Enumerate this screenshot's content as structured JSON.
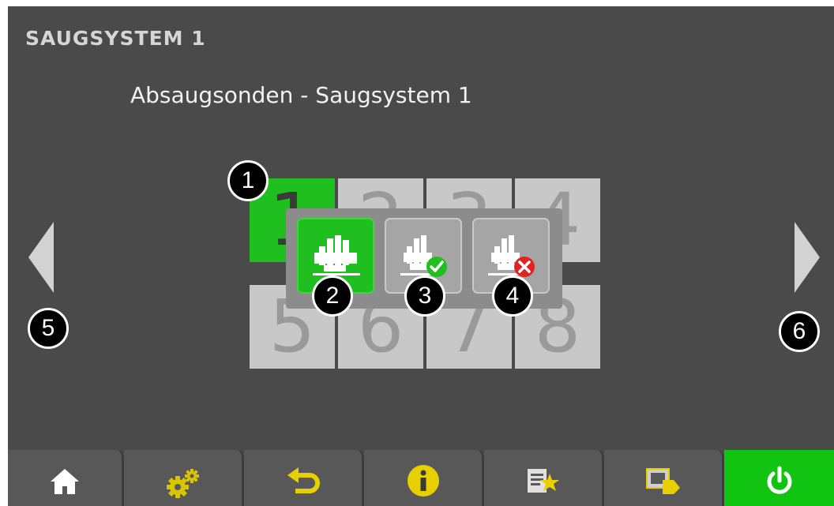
{
  "header": {
    "title": "SAUGSYSTEM 1"
  },
  "main": {
    "subtitle": "Absaugsonden - Saugsystem 1",
    "tiles": [
      "1",
      "2",
      "3",
      "4",
      "5",
      "6",
      "7",
      "8"
    ],
    "selected_tile": "1"
  },
  "callouts": [
    "1",
    "2",
    "3",
    "4",
    "5",
    "6"
  ],
  "popup": {
    "options": [
      "probe-icon",
      "probe-check-icon",
      "probe-cross-icon"
    ]
  },
  "navigation": {
    "prev": "chevron-left-icon",
    "next": "chevron-right-icon"
  },
  "toolbar": {
    "buttons": [
      "home-icon",
      "gears-icon",
      "back-icon",
      "info-icon",
      "favorites-icon",
      "remote-icon",
      "power-icon"
    ]
  },
  "colors": {
    "screen_bg": "#4a4a4a",
    "accent_green": "#1fbf1f",
    "tile_gray": "#c8c8c8",
    "toolbar_bg": "#585858",
    "info_yellow": "#e8d000"
  }
}
